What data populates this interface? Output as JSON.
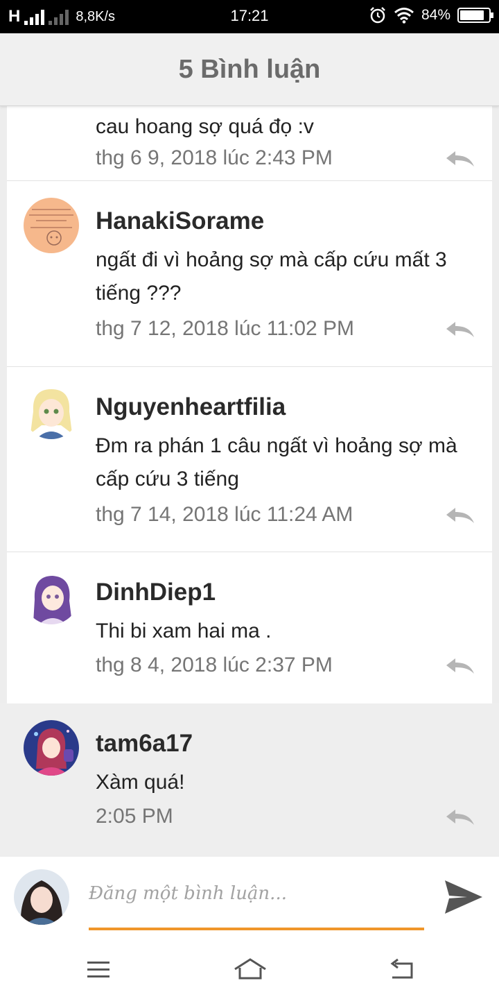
{
  "status_bar": {
    "network": "H",
    "speed": "8,8K/s",
    "time": "17:21",
    "battery_percent": "84%",
    "battery_level": 0.84,
    "icons": [
      "signal-icon",
      "alarm-icon",
      "wifi-icon",
      "battery-icon"
    ]
  },
  "header": {
    "title": "5 Bình luận"
  },
  "comments": [
    {
      "username": "",
      "text": "cau hoang sợ quá đọ :v",
      "time": "thg 6 9, 2018 lúc 2:43 PM"
    },
    {
      "username": "HanakiSorame",
      "text": "ngất đi vì hoảng sợ mà cấp cứu mất 3 tiếng ???",
      "time": "thg 7 12, 2018 lúc 11:02 PM"
    },
    {
      "username": "Nguyenheartfilia",
      "text": "Đm ra phán 1 câu ngất vì hoảng sợ mà cấp cứu 3 tiếng",
      "time": "thg 7 14, 2018 lúc 11:24 AM"
    },
    {
      "username": "DinhDiep1",
      "text": "Thi bi xam hai ma .",
      "time": "thg 8 4, 2018 lúc 2:37 PM"
    },
    {
      "username": "tam6a17",
      "text": "Xàm quá!",
      "time": "2:05 PM"
    }
  ],
  "composer": {
    "placeholder": "Đăng một bình luận..."
  },
  "colors": {
    "accent_underline": "#f0962a",
    "header_bg": "#f0f0f0",
    "highlight_bg": "#eeeeee",
    "icon_gray": "#b5b5b5"
  },
  "nav": {
    "icons": [
      "menu-icon",
      "home-icon",
      "back-icon"
    ]
  }
}
